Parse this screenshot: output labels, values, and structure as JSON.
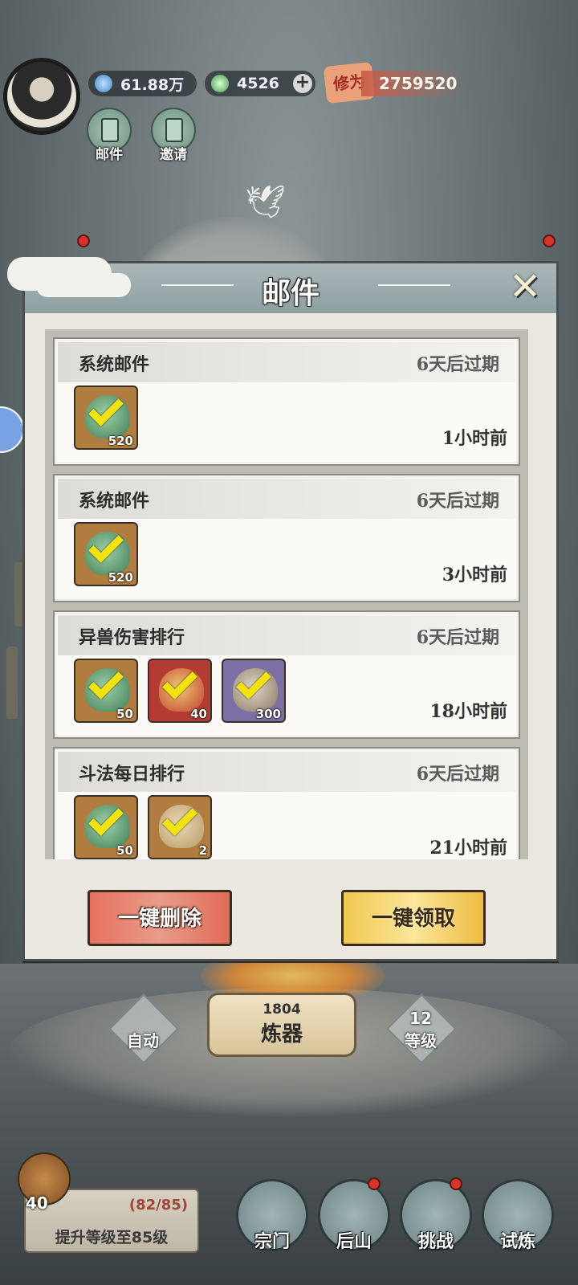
{
  "hud": {
    "currency_1": "61.88万",
    "currency_2": "4526",
    "power_label": "修为",
    "power_value": "2759520",
    "btn_mail": "邮件",
    "btn_invite": "邀请"
  },
  "modal": {
    "title": "邮件",
    "mails": [
      {
        "title": "系统邮件",
        "expire": "6天后过期",
        "time": "1小时前",
        "items": [
          {
            "kind": "jade",
            "color": "brown",
            "qty": "520"
          }
        ]
      },
      {
        "title": "系统邮件",
        "expire": "6天后过期",
        "time": "3小时前",
        "items": [
          {
            "kind": "jade",
            "color": "brown",
            "qty": "520"
          }
        ]
      },
      {
        "title": "异兽伤害排行",
        "expire": "6天后过期",
        "time": "18小时前",
        "items": [
          {
            "kind": "jade",
            "color": "brown",
            "qty": "50"
          },
          {
            "kind": "scroll",
            "color": "red",
            "qty": "40"
          },
          {
            "kind": "stone",
            "color": "purple",
            "qty": "300"
          }
        ]
      },
      {
        "title": "斗法每日排行",
        "expire": "6天后过期",
        "time": "21小时前",
        "items": [
          {
            "kind": "jade",
            "color": "brown",
            "qty": "50"
          },
          {
            "kind": "map",
            "color": "brown",
            "qty": "2"
          }
        ]
      }
    ],
    "btn_delete_all": "一键删除",
    "btn_claim_all": "一键领取"
  },
  "bottom": {
    "auto_label": "自动",
    "forge_count": "1804",
    "forge_label": "炼器",
    "level_num": "12",
    "level_label": "等级",
    "chest_level": "40",
    "task_progress": "(82/85)",
    "task_text": "提升等级至85级",
    "nav": [
      "宗门",
      "后山",
      "挑战",
      "试炼"
    ]
  },
  "colors": {
    "delete_button": "#e7715e",
    "claim_button": "#f1c950",
    "checkmark": "#f2e30e"
  }
}
